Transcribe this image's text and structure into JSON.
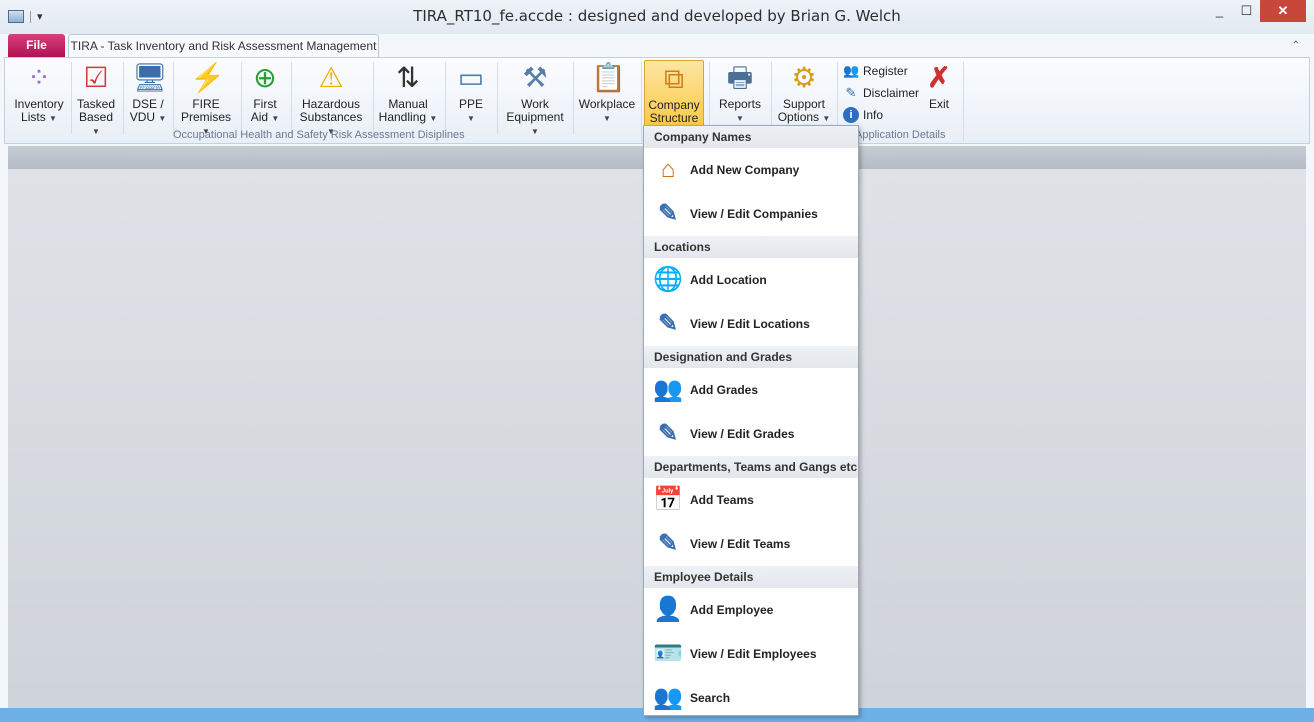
{
  "window": {
    "title": "TIRA_RT10_fe.accde : designed and developed by Brian G. Welch",
    "controls": [
      "_",
      "☐",
      "✕"
    ]
  },
  "tabs": {
    "file": "File",
    "main": "TIRA - Task Inventory and Risk Assessment Management"
  },
  "ribbon": {
    "groups": {
      "ohs": "Occupational Health and Safety Risk Assessment Disiplines",
      "app": "Application Details"
    },
    "buttons": {
      "inventory_1": "Inventory",
      "inventory_2": "Lists",
      "tasked_1": "Tasked",
      "tasked_2": "Based",
      "dse_1": "DSE /",
      "dse_2": "VDU",
      "fire_1": "FIRE",
      "fire_2": "Premises",
      "firstaid_1": "First",
      "firstaid_2": "Aid",
      "hazard_1": "Hazardous",
      "hazard_2": "Substances",
      "manual_1": "Manual",
      "manual_2": "Handling",
      "ppe_1": "PPE",
      "work_1": "Work",
      "work_2": "Equipment",
      "workplace_1": "Workplace",
      "company_1": "Company",
      "company_2": "Structure",
      "reports_1": "Reports",
      "support_1": "Support",
      "support_2": "Options",
      "register": "Register",
      "disclaimer": "Disclaimer",
      "info": "Info",
      "exit": "Exit"
    }
  },
  "dropdown": {
    "sections": [
      {
        "header": "Company Names",
        "items": [
          {
            "label": "Add New Company",
            "icon": "house-icon"
          },
          {
            "label": "View / Edit Companies",
            "icon": "edit-icon"
          }
        ]
      },
      {
        "header": "Locations",
        "items": [
          {
            "label": "Add Location",
            "icon": "globe-icon"
          },
          {
            "label": "View / Edit Locations",
            "icon": "edit-icon"
          }
        ]
      },
      {
        "header": "Designation and Grades",
        "items": [
          {
            "label": "Add Grades",
            "icon": "grades-icon"
          },
          {
            "label": "View / Edit Grades",
            "icon": "edit-icon"
          }
        ]
      },
      {
        "header": "Departments, Teams and Gangs etc",
        "items": [
          {
            "label": "Add Teams",
            "icon": "teams-icon"
          },
          {
            "label": "View / Edit Teams",
            "icon": "edit-icon"
          }
        ]
      },
      {
        "header": "Employee Details",
        "items": [
          {
            "label": "Add Employee",
            "icon": "add-employee-icon"
          },
          {
            "label": "View / Edit Employees",
            "icon": "employee-card-icon"
          },
          {
            "label": "Search",
            "icon": "search-people-icon"
          }
        ]
      }
    ]
  },
  "colors": {
    "file_tab": "#b01253",
    "active_button": "#f9c945",
    "close_button": "#c7473a"
  }
}
